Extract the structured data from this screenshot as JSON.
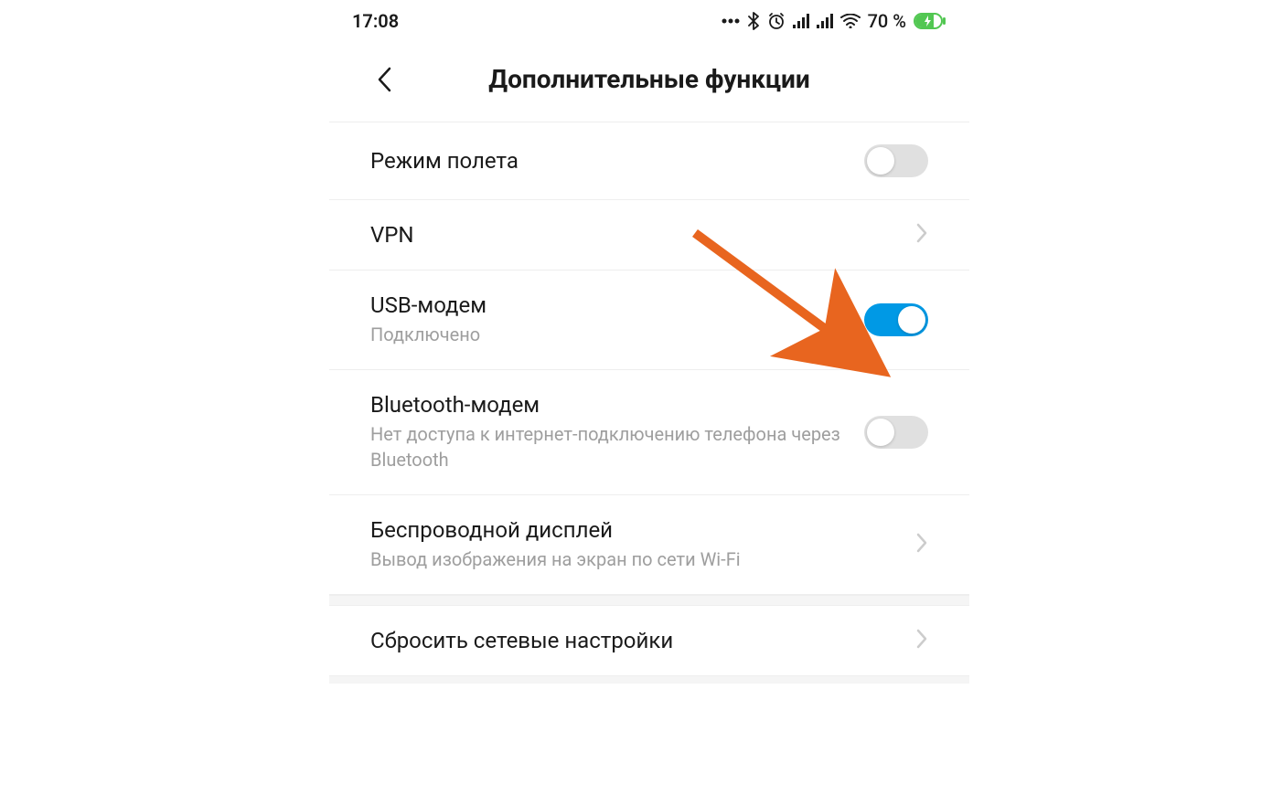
{
  "statusBar": {
    "time": "17:08",
    "batteryText": "70 %"
  },
  "header": {
    "title": "Дополнительные функции"
  },
  "items": {
    "airplane": {
      "label": "Режим полета"
    },
    "vpn": {
      "label": "VPN"
    },
    "usbModem": {
      "label": "USB-модем",
      "subtitle": "Подключено"
    },
    "bluetoothModem": {
      "label": "Bluetooth-модем",
      "subtitle": "Нет доступа к интернет-подключению телефона через Bluetooth"
    },
    "wirelessDisplay": {
      "label": "Беспроводной дисплей",
      "subtitle": "Вывод изображения на экран по сети Wi-Fi"
    },
    "resetNetwork": {
      "label": "Сбросить сетевые настройки"
    }
  }
}
